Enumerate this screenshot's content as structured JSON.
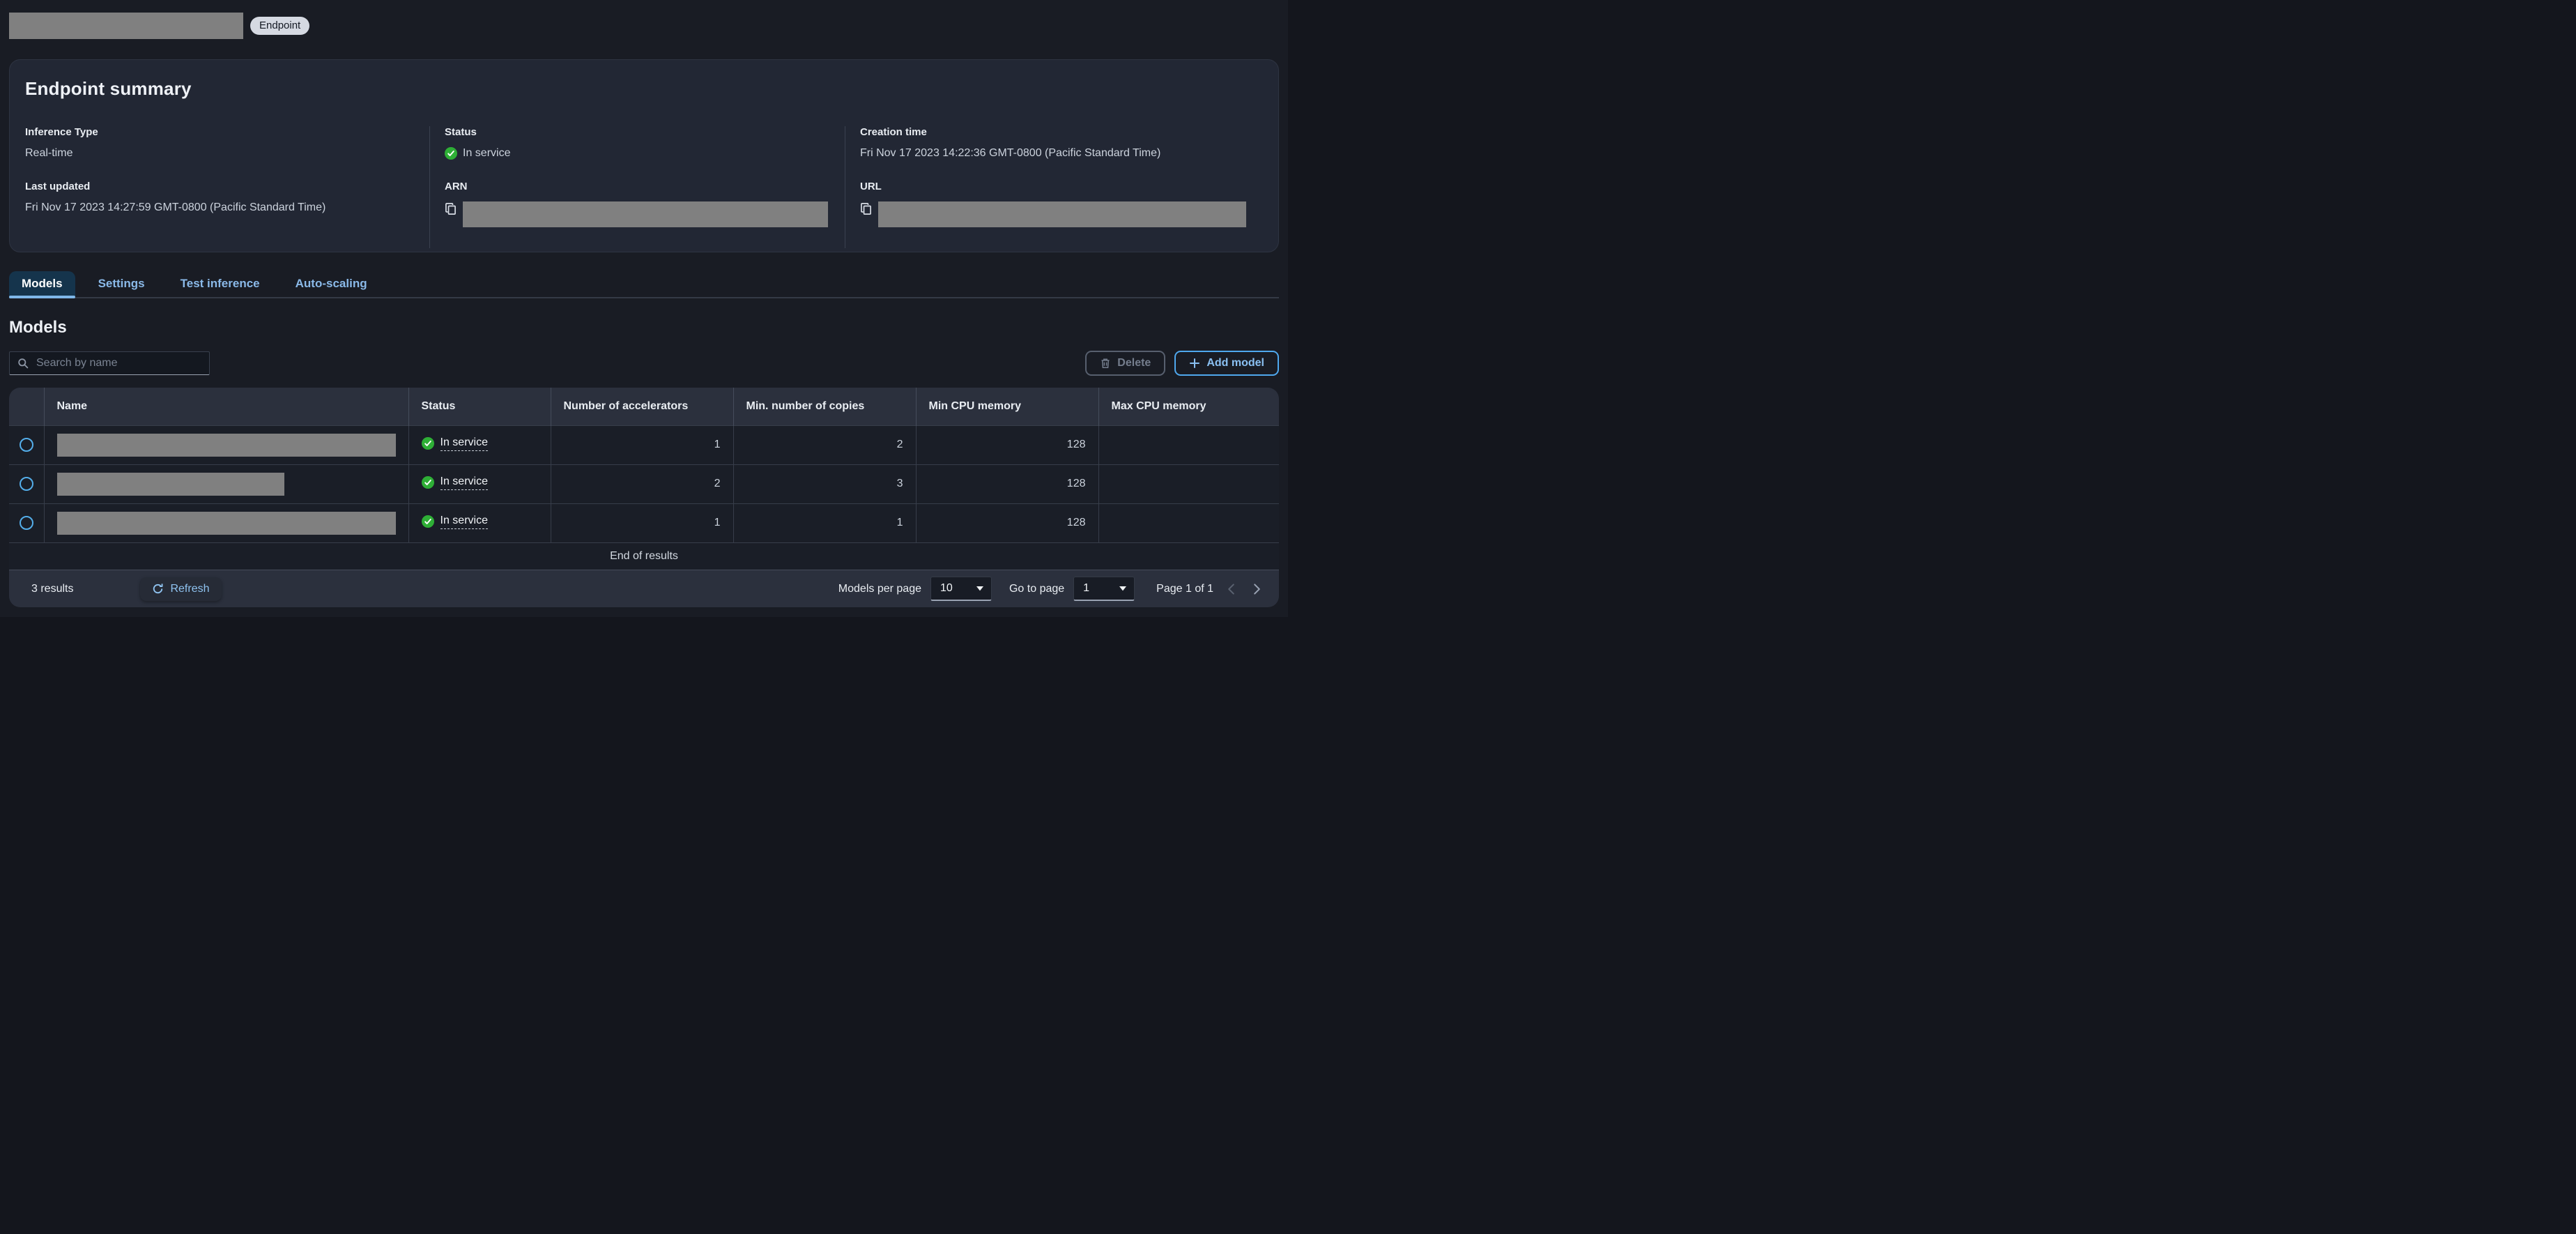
{
  "header": {
    "badge_label": "Endpoint"
  },
  "summary": {
    "title": "Endpoint summary",
    "inference_type": {
      "label": "Inference Type",
      "value": "Real-time"
    },
    "status": {
      "label": "Status",
      "value": "In service"
    },
    "creation_time": {
      "label": "Creation time",
      "value": "Fri Nov 17 2023 14:22:36 GMT-0800 (Pacific Standard Time)"
    },
    "last_updated": {
      "label": "Last updated",
      "value": "Fri Nov 17 2023 14:27:59 GMT-0800 (Pacific Standard Time)"
    },
    "arn": {
      "label": "ARN"
    },
    "url": {
      "label": "URL"
    }
  },
  "tabs": [
    {
      "label": "Models",
      "active": true
    },
    {
      "label": "Settings",
      "active": false
    },
    {
      "label": "Test inference",
      "active": false
    },
    {
      "label": "Auto-scaling",
      "active": false
    }
  ],
  "models": {
    "heading": "Models",
    "search_placeholder": "Search by name",
    "delete_button": "Delete",
    "add_button": "Add model",
    "table": {
      "columns": [
        "Name",
        "Status",
        "Number of accelerators",
        "Min. number of copies",
        "Min CPU memory",
        "Max CPU memory"
      ],
      "rows": [
        {
          "status": "In service",
          "accelerators": "1",
          "min_copies": "2",
          "min_cpu_memory": "128",
          "max_cpu_memory": ""
        },
        {
          "status": "In service",
          "accelerators": "2",
          "min_copies": "3",
          "min_cpu_memory": "128",
          "max_cpu_memory": ""
        },
        {
          "status": "In service",
          "accelerators": "1",
          "min_copies": "1",
          "min_cpu_memory": "128",
          "max_cpu_memory": ""
        }
      ],
      "end_of_results": "End of results"
    },
    "pagination": {
      "results_text": "3 results",
      "refresh_label": "Refresh",
      "per_page_label": "Models per page",
      "per_page_value": "10",
      "goto_label": "Go to page",
      "goto_value": "1",
      "page_text": "Page 1 of 1"
    }
  },
  "colors": {
    "accent_blue": "#539fe5",
    "link_blue": "#89bdee",
    "status_green": "#2eaf36",
    "badge_bg": "#d5d9e2",
    "redaction_gray": "#808080",
    "panel_bg": "#222734",
    "page_bg": "#191c24"
  }
}
